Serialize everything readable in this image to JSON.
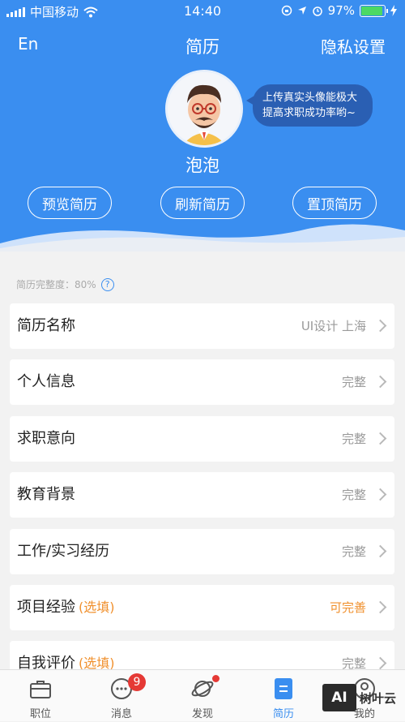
{
  "status_bar": {
    "carrier": "中国移动",
    "time": "14:40",
    "battery": "97%"
  },
  "nav": {
    "lang": "En",
    "title": "简历",
    "privacy": "隐私设置"
  },
  "profile": {
    "bubble_line1": "上传真实头像能极大",
    "bubble_line2": "提高求职成功率哟~",
    "username": "泡泡"
  },
  "actions": [
    "预览简历",
    "刷新简历",
    "置顶简历"
  ],
  "completeness": {
    "label": "简历完整度：80%",
    "help": "?"
  },
  "sections": [
    {
      "label": "简历名称",
      "optional": "",
      "value": "UI设计 上海"
    },
    {
      "label": "个人信息",
      "optional": "",
      "value": "完整"
    },
    {
      "label": "求职意向",
      "optional": "",
      "value": "完整"
    },
    {
      "label": "教育背景",
      "optional": "",
      "value": "完整"
    },
    {
      "label": "工作/实习经历",
      "optional": "",
      "value": "完整"
    },
    {
      "label": "项目经验",
      "optional": "(选填)",
      "value": "可完善"
    },
    {
      "label": "自我评价",
      "optional": "(选填)",
      "value": "完整"
    }
  ],
  "tabs": [
    {
      "label": "职位"
    },
    {
      "label": "消息",
      "badge": "9"
    },
    {
      "label": "发现"
    },
    {
      "label": "简历"
    },
    {
      "label": "我的"
    }
  ],
  "watermark": {
    "box": "AI",
    "text": "树叶云"
  },
  "colors": {
    "primary": "#3a8ef0",
    "accent_orange": "#f0902d",
    "badge_red": "#e53935"
  }
}
